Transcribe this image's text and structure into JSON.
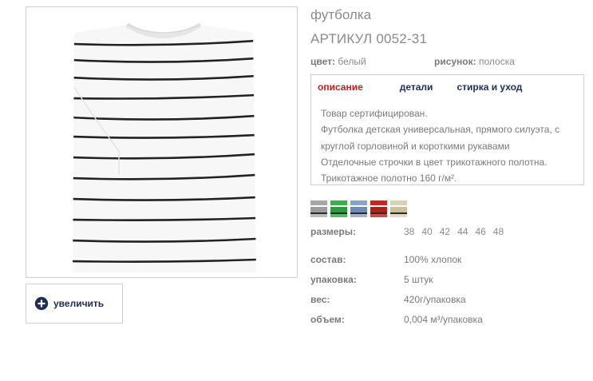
{
  "product": {
    "title": "футболка",
    "article": "АРТИКУЛ 0052-31",
    "color_label": "цвет:",
    "color_value": "белый",
    "pattern_label": "рисунок:",
    "pattern_value": "полоска"
  },
  "zoom": {
    "label": "увеличить"
  },
  "tabs": {
    "description": "описание",
    "details": "детали",
    "care": "стирка и уход"
  },
  "description": [
    "Товар сертифицирован.",
    "Футболка детская универсальная, прямого силуэта, с",
    "круглой горловиной и короткими рукавами",
    "Отделочные строчки в цвет трикотажного полотна.",
    "Трикотажное полотно 160 г/м²."
  ],
  "swatches": [
    {
      "top": "#a7a7a7",
      "bottom": "#9c9c9c",
      "base": "#bdbdbd"
    },
    {
      "top": "#3ab04a",
      "bottom": "#2e9a3e",
      "base": "#52c060"
    },
    {
      "top": "#8aa3c8",
      "bottom": "#6f8ab5",
      "base": "#9fb4d4"
    },
    {
      "top": "#c8261f",
      "bottom": "#b01e18",
      "base": "#d8453f"
    },
    {
      "top": "#d9d1b0",
      "bottom": "#cbc29c",
      "base": "#e2dbc0"
    }
  ],
  "sizes": {
    "label": "размеры:",
    "values": [
      "38",
      "40",
      "42",
      "44",
      "46",
      "48"
    ]
  },
  "specs": {
    "composition_label": "состав:",
    "composition_value": "100% хлопок",
    "packing_label": "упаковка:",
    "packing_value": "5 штук",
    "weight_label": "вес:",
    "weight_value": "420г/упаковка",
    "volume_label": "объем:",
    "volume_value": "0,004 м³/упаковка"
  },
  "icons": {
    "zoom": "plus-circle-icon"
  },
  "colors": {
    "accent_red": "#c0201c",
    "navy": "#1f2d55",
    "border": "#cfcfcf"
  }
}
